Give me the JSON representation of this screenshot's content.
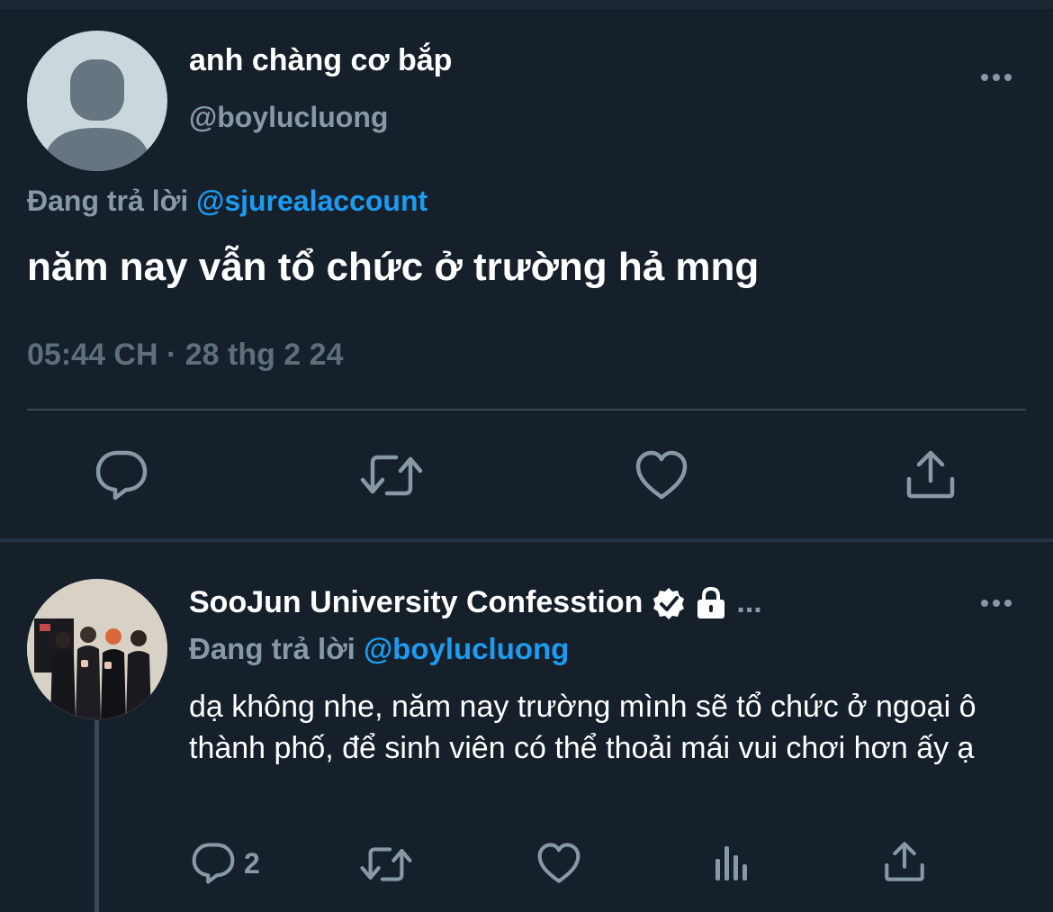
{
  "main_tweet": {
    "display_name": "anh chàng cơ bắp",
    "handle": "@boylucluong",
    "replying_prefix": "Đang trả lời",
    "replying_to": "@sjurealaccount",
    "text": "năm nay vẫn tổ chức ở trường hả mng",
    "timestamp": "05:44 CH · 28 thg 2 24",
    "actions": [
      {
        "icon": "reply-icon"
      },
      {
        "icon": "retweet-icon"
      },
      {
        "icon": "like-icon"
      },
      {
        "icon": "share-icon"
      }
    ]
  },
  "reply_tweet": {
    "display_name": "SooJun University Confesstion",
    "badges": [
      "verified-icon",
      "lock-icon"
    ],
    "truncation": "...",
    "replying_prefix": "Đang trả lời",
    "replying_to": "@boylucluong",
    "text": "dạ không nhe, năm nay trường mình sẽ tổ chức ở ngoại ô thành phố, để sinh viên có thể thoải mái vui chơi hơn ấy ạ",
    "actions": [
      {
        "icon": "reply-icon",
        "count": "2"
      },
      {
        "icon": "retweet-icon"
      },
      {
        "icon": "like-icon"
      },
      {
        "icon": "analytics-icon"
      },
      {
        "icon": "share-icon"
      }
    ]
  },
  "colors": {
    "background": "#15202b",
    "text_primary": "#ffffff",
    "text_secondary": "#8899a6",
    "link": "#1d9bf0",
    "divider": "#38444d"
  }
}
